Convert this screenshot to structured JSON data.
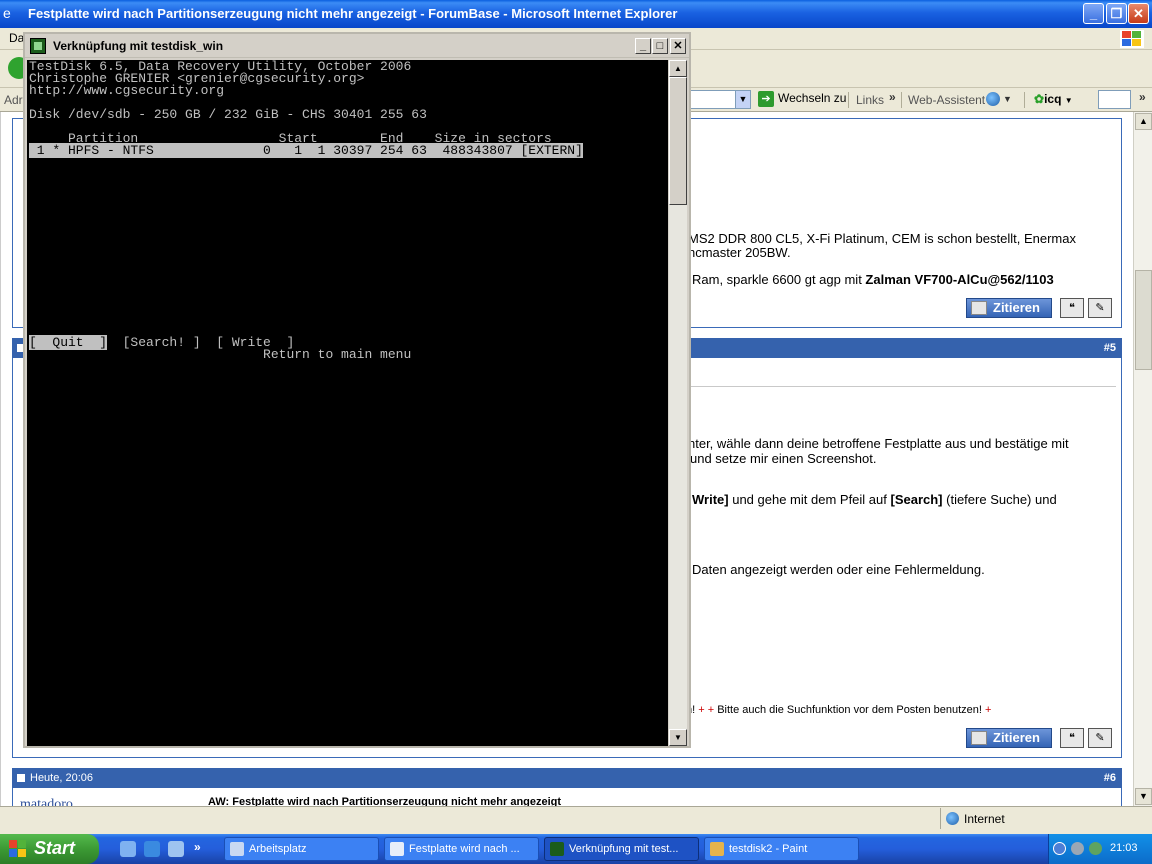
{
  "ie": {
    "title": "Festplatte wird nach Partitionserzeugung nicht mehr angezeigt - ForumBase - Microsoft Internet Explorer",
    "menu_fragment": "Da",
    "address_label": "Adr",
    "go_label": "Wechseln zu",
    "links_label": "Links",
    "web_assistant": "Web-Assistent",
    "icq_label": "icq",
    "status_zone": "Internet"
  },
  "forum": {
    "post4": {
      "line1": "MS2 DDR 800 CL5, X-Fi Platinum, CEM is schon bestellt, Enermax",
      "line2": "ncmaster 205BW.",
      "line3_pre": "Ram, sparkle 6600 gt agp mit ",
      "line3_bold": "Zalman VF700-AlCu@562/1103",
      "quote_label": "Zitieren"
    },
    "post5": {
      "number": "#5",
      "line1": "nter, wähle dann deine betroffene Festplatte aus und bestätige mit",
      "line2": " und setze mir einen Screenshot.",
      "line3_b1": "Write]",
      "line3_mid": " und gehe mit dem Pfeil auf ",
      "line3_b2": "[Search]",
      "line3_end": " (tiefere Suche) und",
      "line4": "Daten angezeigt werden oder eine Fehlermeldung.",
      "sig_a": "h! ",
      "sig_plus": "+ +",
      "sig_b": " Bitte auch die Suchfunktion vor dem Posten benutzen! ",
      "sig_end": "+",
      "quote_label": "Zitieren"
    },
    "post6": {
      "date": "Heute, 20:06",
      "number": "#6",
      "author": "matadoro",
      "title": "AW: Festplatte wird nach Partitionserzeugung nicht mehr angezeigt"
    }
  },
  "console": {
    "title": "Verknüpfung mit testdisk_win",
    "lines": [
      "TestDisk 6.5, Data Recovery Utility, October 2006",
      "Christophe GRENIER <grenier@cgsecurity.org>",
      "http://www.cgsecurity.org",
      "",
      "Disk /dev/sdb - 250 GB / 232 GiB - CHS 30401 255 63",
      "",
      "     Partition                  Start        End    Size in sectors"
    ],
    "partition_row": " 1 * HPFS - NTFS              0   1  1 30397 254 63  488343807 [EXTERN]",
    "menu_quit": "[  Quit  ]",
    "menu_rest": "  [Search! ]  [ Write  ]",
    "hint": "                              Return to main menu"
  },
  "taskbar": {
    "start_label": "Start",
    "tasks": [
      {
        "label": "Arbeitsplatz"
      },
      {
        "label": "Festplatte wird nach ..."
      },
      {
        "label": "Verknüpfung mit test..."
      },
      {
        "label": "testdisk2 - Paint"
      }
    ],
    "clock": "21:03"
  }
}
